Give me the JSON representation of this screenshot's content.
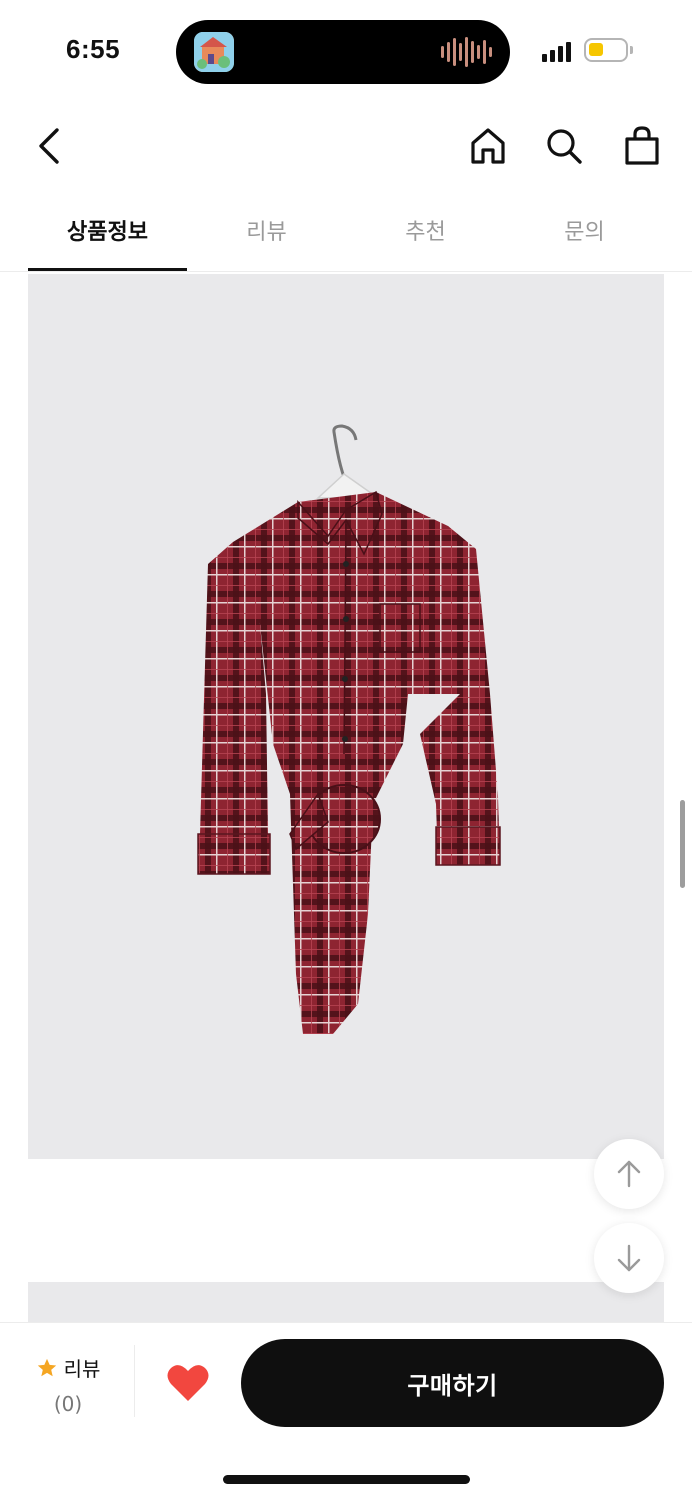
{
  "status_bar": {
    "time": "6:55",
    "battery_level": 0.4,
    "battery_color": "#f6c600"
  },
  "top_nav": {
    "icons": [
      "back-icon",
      "home-icon",
      "search-icon",
      "shopping-bag-icon"
    ]
  },
  "tabs": [
    {
      "label": "상품정보",
      "active": true
    },
    {
      "label": "리뷰",
      "active": false
    },
    {
      "label": "추천",
      "active": false
    },
    {
      "label": "문의",
      "active": false
    }
  ],
  "product": {
    "image_subject": "red plaid tie-waist shirt on hanger",
    "shirt_color": "#8e2431"
  },
  "floating_buttons": {
    "up_icon": "arrow-up-icon",
    "down_icon": "arrow-down-icon"
  },
  "bottom_bar": {
    "review_label": "리뷰",
    "review_count": "(0)",
    "star_color": "#f5a623",
    "heart_color": "#f2473f",
    "buy_label": "구매하기"
  }
}
